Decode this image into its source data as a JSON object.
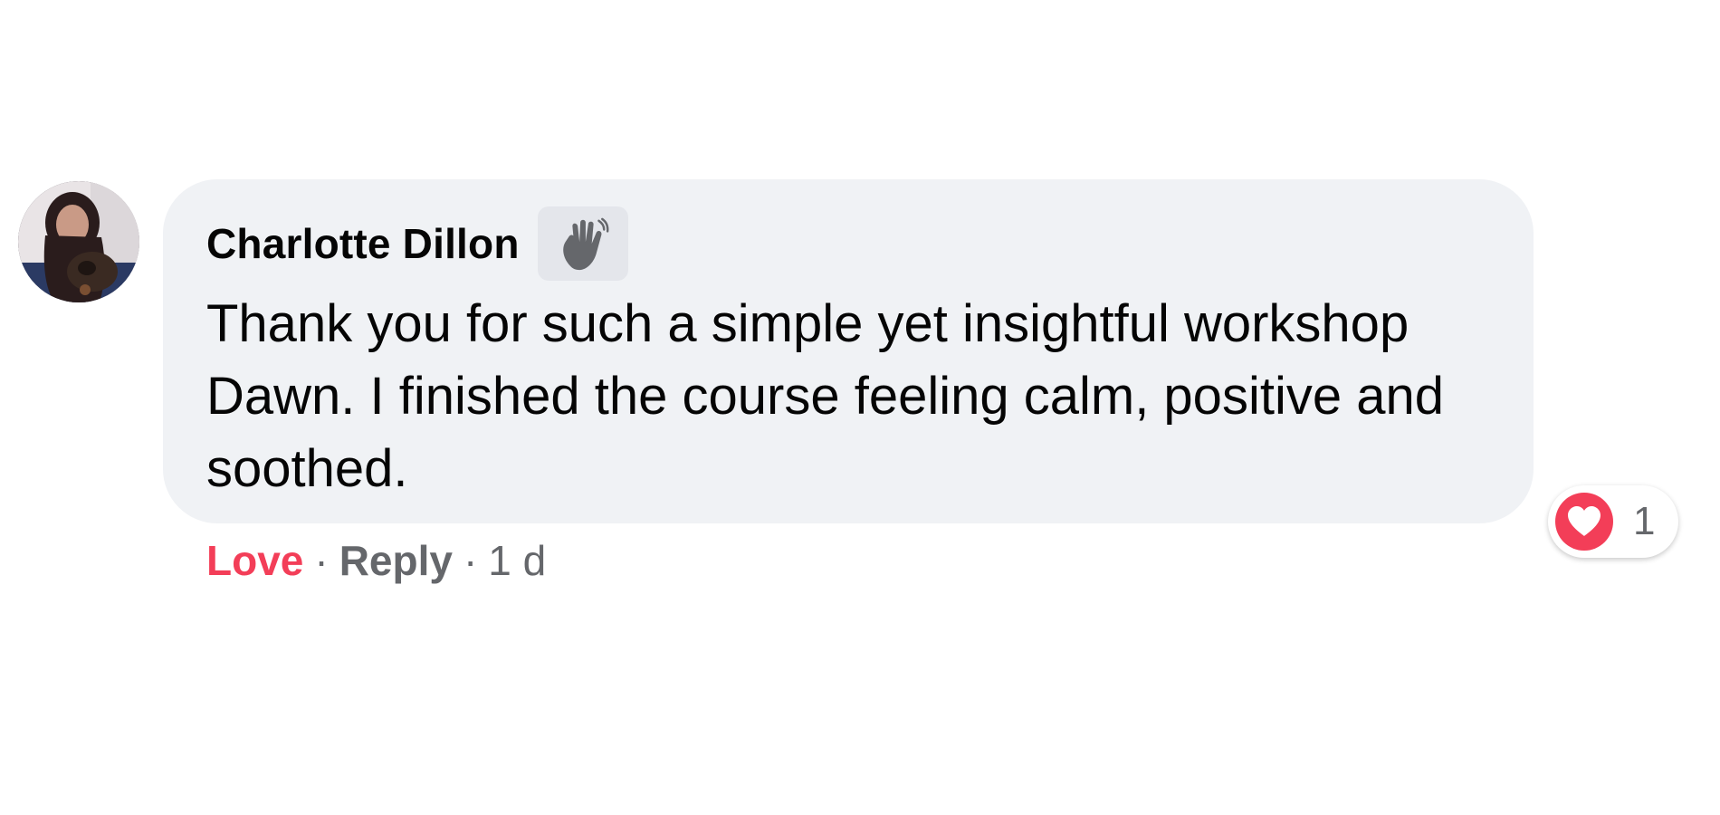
{
  "comment": {
    "author": "Charlotte Dillon",
    "badge_icon": "waving-hand-icon",
    "text": "Thank you for such a simple yet insightful workshop Dawn. I finished the course feeling calm, positive and soothed.",
    "reaction": {
      "icon": "heart-icon",
      "color": "#f33e58",
      "count": "1"
    },
    "actions": {
      "love_label": "Love",
      "separator": "·",
      "reply_label": "Reply",
      "time": "1 d"
    }
  },
  "colors": {
    "bubble_bg": "#f0f2f5",
    "love": "#f33e58",
    "secondary_text": "#65676b",
    "primary_text": "#050505"
  }
}
